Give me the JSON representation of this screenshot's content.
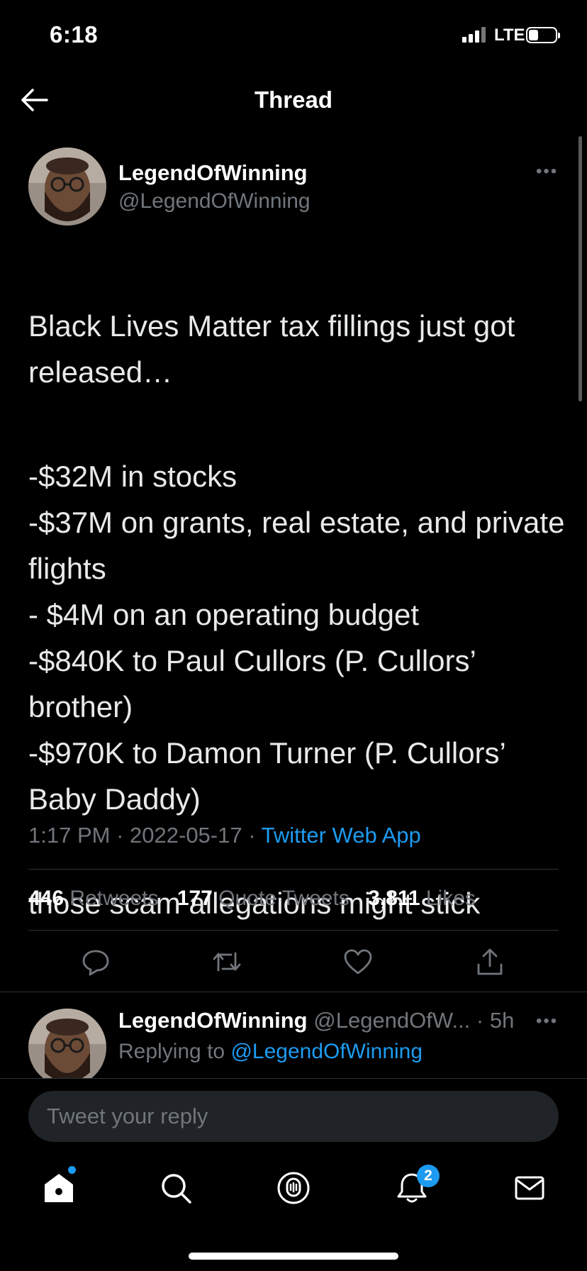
{
  "status_bar": {
    "time": "6:18",
    "network": "LTE"
  },
  "header": {
    "title": "Thread"
  },
  "tweet": {
    "author_name": "LegendOfWinning",
    "author_handle": "@LegendOfWinning",
    "paragraphs": [
      "Black Lives Matter tax fillings just got released…",
      "-$32M in stocks\n-$37M on grants, real estate, and private flights\n- $4M on an operating budget\n-$840K to Paul Cullors (P. Cullors’ brother)\n-$970K to Damon Turner (P. Cullors’ Baby Daddy)",
      "those scam allegations might stick"
    ],
    "time": "1:17 PM",
    "date": "2022-05-17",
    "separator": "·",
    "source": "Twitter Web App",
    "stats": {
      "retweets_count": "446",
      "retweets_label": "Retweets",
      "quotes_count": "177",
      "quotes_label": "Quote Tweets",
      "likes_count": "3,811",
      "likes_label": "Likes"
    }
  },
  "reply": {
    "author_name": "LegendOfWinning",
    "author_handle": "@LegendOfW...",
    "time": "· 5h",
    "replying_label": "Replying to",
    "replying_to": "@LegendOfWinning"
  },
  "compose": {
    "placeholder": "Tweet your reply"
  },
  "tab_bar": {
    "notifications_badge": "2"
  },
  "colors": {
    "accent": "#1d9bf0",
    "background": "#000000",
    "muted": "#71767b",
    "divider": "#2f3336"
  }
}
